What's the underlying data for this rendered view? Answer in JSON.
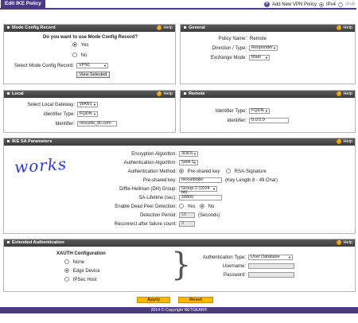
{
  "header": {
    "title": "Edit IKE Policy",
    "add_vpn_policy": "Add New VPN Policy",
    "ipv4": "IPv4",
    "ipv6": "IPv6"
  },
  "help_label": "Help",
  "mode_config": {
    "title": "Mode Config Record",
    "question": "Do you want to use Mode Config Record?",
    "yes": "Yes",
    "no": "No",
    "select_label": "Select Mode Config Record:",
    "select_value": "VPN1",
    "view_selected": "View Selected"
  },
  "general": {
    "title": "General",
    "policy_name_label": "Policy Name:",
    "policy_name_value": "Remote",
    "direction_label": "Direction / Type:",
    "direction_value": "Responder",
    "exchange_label": "Exchange Mode:",
    "exchange_value": "Main"
  },
  "local": {
    "title": "Local",
    "gateway_label": "Select Local Gateway:",
    "gateway_value": "WAN1",
    "id_type_label": "Identifier Type:",
    "id_type_value": "FQDN",
    "identifier_label": "Identifier:",
    "identifier_value": "nexusbi_dc.com"
  },
  "remote": {
    "title": "Remote",
    "id_type_label": "Identifier Type:",
    "id_type_value": "FQDN",
    "identifier_label": "Identifier:",
    "identifier_value": "0.0.0.0"
  },
  "ike_sa": {
    "title": "IKE SA Parameters",
    "handwritten_note": "works",
    "encryption_label": "Encryption Algorithm:",
    "encryption_value": "3DES",
    "auth_alg_label": "Authentication Algorithm:",
    "auth_alg_value": "SHA-1",
    "auth_method_label": "Authentication Method:",
    "auth_method_psk": "Pre-shared key",
    "auth_method_rsa": "RSA-Signature",
    "psk_label": "Pre-shared key:",
    "psk_value": "nexusbiabc",
    "psk_hint": "(Key Length 8 - 49 Char)",
    "dh_label": "Diffie-Hellman (DH) Group:",
    "dh_value": "Group 2 (1024 bit)",
    "lifetime_label": "SA-Lifetime (sec):",
    "lifetime_value": "28800",
    "dpd_label": "Enable Dead Peer Detection:",
    "dpd_yes": "Yes",
    "dpd_no": "No",
    "period_label": "Detection Period:",
    "period_value": "10",
    "period_unit": "(Seconds)",
    "reconnect_label": "Reconnect after failure count:",
    "reconnect_value": "3"
  },
  "ext_auth": {
    "title": "Extended Authentication",
    "xauth_title": "XAUTH Configuration",
    "none": "None",
    "edge_device": "Edge Device",
    "ipsec_host": "IPSec Host",
    "auth_type_label": "Authentication Type:",
    "auth_type_value": "User Database",
    "username_label": "Username:",
    "password_label": "Password:"
  },
  "actions": {
    "apply": "Apply",
    "reset": "Reset"
  },
  "footer": "2014 © Copyright NETGEAR®"
}
